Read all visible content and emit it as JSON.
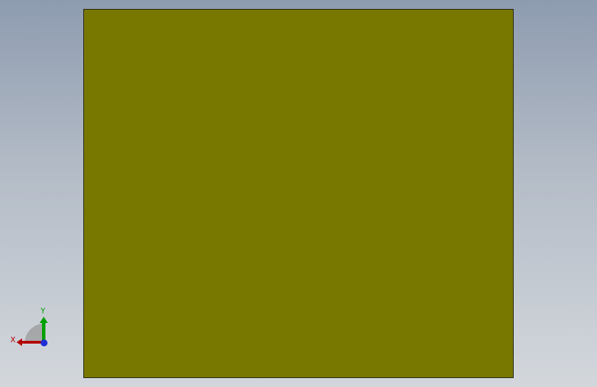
{
  "viewport": {
    "background_top": "#8e9cb0",
    "background_bottom": "#d3d7dc"
  },
  "model": {
    "face_color": "#787800",
    "edge_color": "#1e1e10"
  },
  "triad": {
    "x_label": "X",
    "y_label": "Y",
    "x_color": "#b40000",
    "y_color": "#00a000",
    "z_color": "#1f2fd6"
  }
}
